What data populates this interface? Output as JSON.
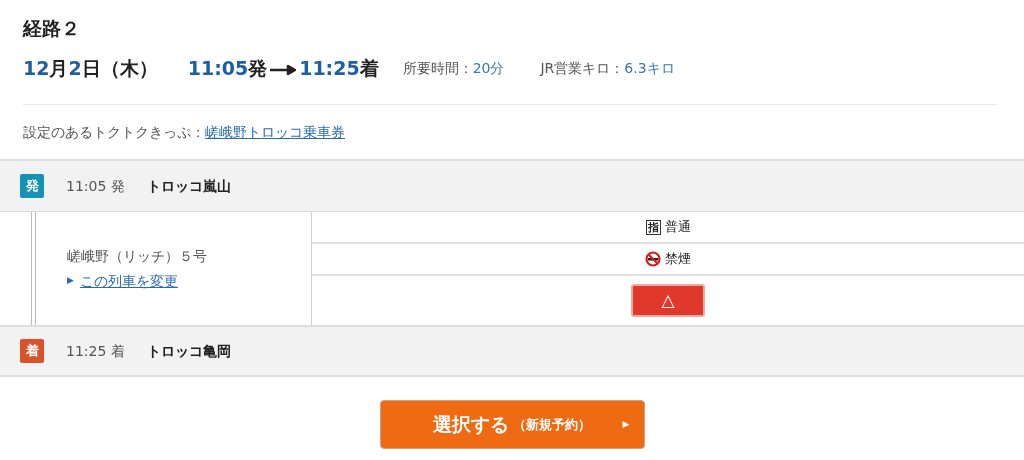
{
  "title": "経路２",
  "date": [
    {
      "text": "12",
      "kind": "number"
    },
    {
      "text": "月",
      "kind": "unit"
    },
    {
      "text": "2",
      "kind": "number"
    },
    {
      "text": "日（木）",
      "kind": "unit"
    }
  ],
  "departure_time": [
    {
      "text": "11:05",
      "kind": "number"
    },
    {
      "text": "発",
      "kind": "unit"
    }
  ],
  "arrival_time": [
    {
      "text": "11:25",
      "kind": "number"
    },
    {
      "text": "着",
      "kind": "unit"
    }
  ],
  "duration": {
    "label": "所要時間：",
    "value": "20分"
  },
  "distance": {
    "label": "JR営業キロ：",
    "value": "6.3キロ"
  },
  "ticket": {
    "label": "設定のあるトクトクきっぷ：",
    "link": "嵯峨野トロッコ乗車券"
  },
  "stops": [
    {
      "kind": "departure",
      "badge": "発",
      "time": "11:05 発",
      "station": "トロッコ嵐山"
    },
    {
      "kind": "arrival",
      "badge": "着",
      "time": "11:25 着",
      "station": "トロッコ亀岡"
    }
  ],
  "train": {
    "name": "嵯峨野（リッチ）５号",
    "link_marker": "▶",
    "link": "この列車を変更",
    "features": [
      {
        "kind": "seat",
        "icon_char": "指",
        "label": "普通"
      },
      {
        "kind": "smoking",
        "label": "禁煙"
      },
      {
        "kind": "availability",
        "symbol": "△"
      }
    ]
  },
  "select_button": {
    "label": "選択する",
    "note": "（新規予約）",
    "arrow": "▶"
  }
}
